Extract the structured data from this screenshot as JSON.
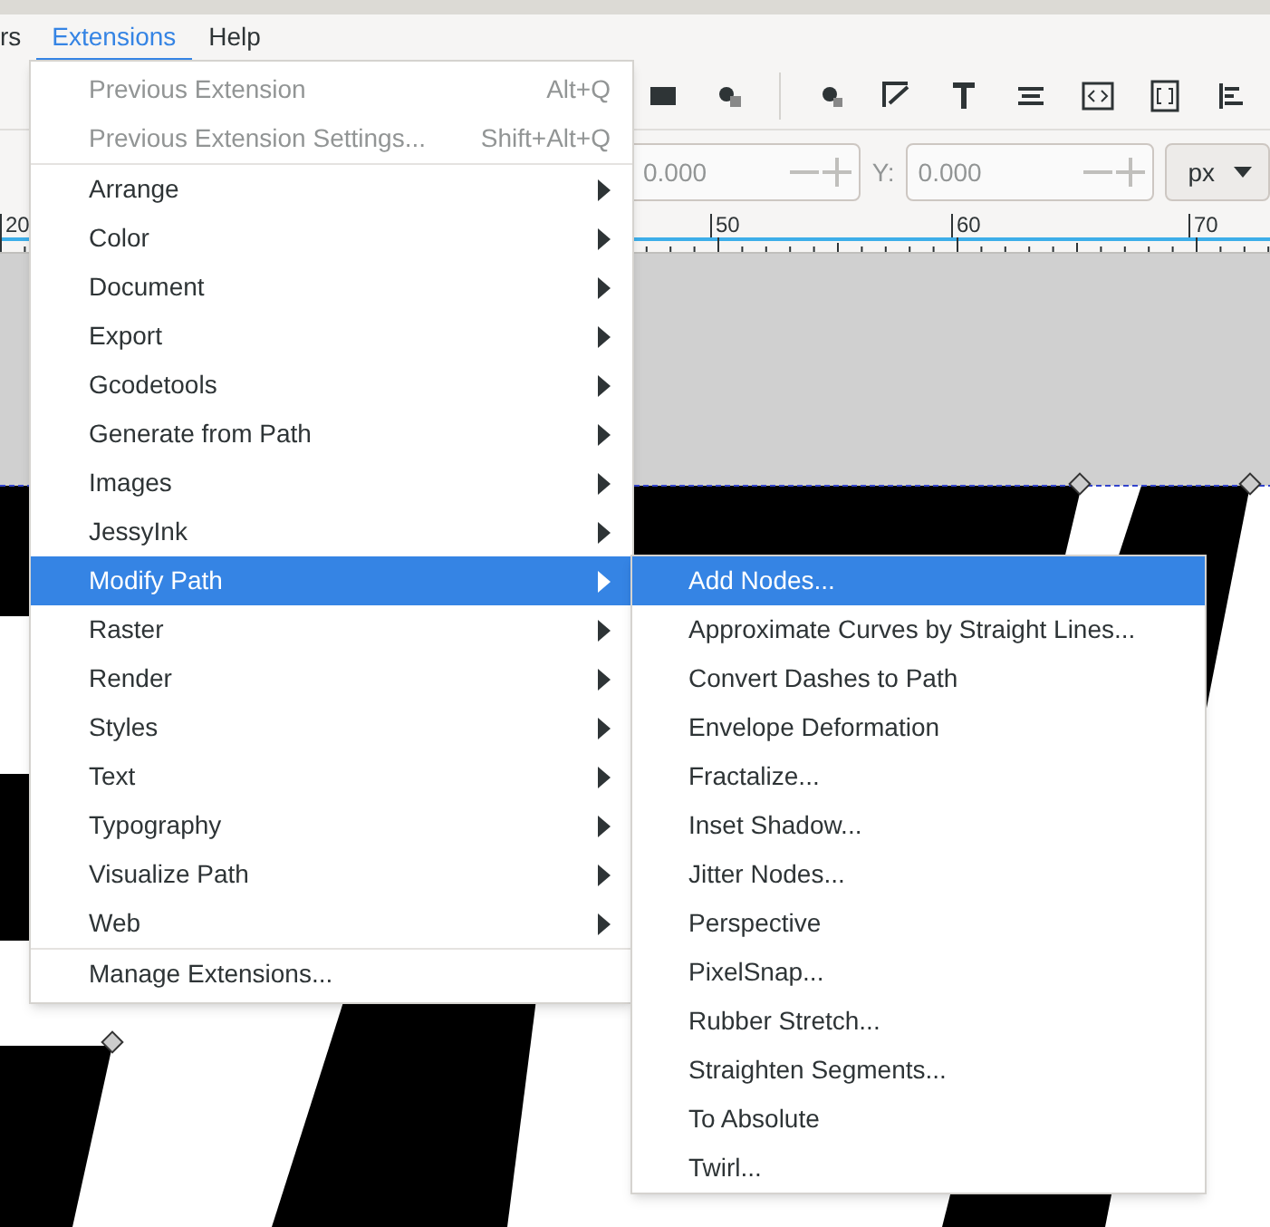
{
  "menubar": [
    {
      "label": "rs",
      "selected": false
    },
    {
      "label": "Extensions",
      "selected": true
    },
    {
      "label": "Help",
      "selected": false
    }
  ],
  "coordinates": {
    "x_value": "0.000",
    "y_label": "Y:",
    "y_value": "0.000",
    "unit": "px"
  },
  "ruler": {
    "labels": [
      "20",
      "50",
      "60",
      "70"
    ]
  },
  "extensions_menu": {
    "sections": [
      [
        {
          "kind": "action",
          "label": "Previous Extension",
          "shortcut": "Alt+Q",
          "disabled": true,
          "selected": false
        },
        {
          "kind": "action",
          "label": "Previous Extension Settings...",
          "shortcut": "Shift+Alt+Q",
          "disabled": true,
          "selected": false
        }
      ],
      [
        {
          "kind": "submenu",
          "label": "Arrange",
          "disabled": false,
          "selected": false
        },
        {
          "kind": "submenu",
          "label": "Color",
          "disabled": false,
          "selected": false
        },
        {
          "kind": "submenu",
          "label": "Document",
          "disabled": false,
          "selected": false
        },
        {
          "kind": "submenu",
          "label": "Export",
          "disabled": false,
          "selected": false
        },
        {
          "kind": "submenu",
          "label": "Gcodetools",
          "disabled": false,
          "selected": false
        },
        {
          "kind": "submenu",
          "label": "Generate from Path",
          "disabled": false,
          "selected": false
        },
        {
          "kind": "submenu",
          "label": "Images",
          "disabled": false,
          "selected": false
        },
        {
          "kind": "submenu",
          "label": "JessyInk",
          "disabled": false,
          "selected": false
        },
        {
          "kind": "submenu",
          "label": "Modify Path",
          "selected": true
        },
        {
          "kind": "submenu",
          "label": "Raster",
          "disabled": false,
          "selected": false
        },
        {
          "kind": "submenu",
          "label": "Render",
          "disabled": false,
          "selected": false
        },
        {
          "kind": "submenu",
          "label": "Styles",
          "disabled": false,
          "selected": false
        },
        {
          "kind": "submenu",
          "label": "Text",
          "disabled": false,
          "selected": false
        },
        {
          "kind": "submenu",
          "label": "Typography",
          "disabled": false,
          "selected": false
        },
        {
          "kind": "submenu",
          "label": "Visualize Path",
          "disabled": false,
          "selected": false
        },
        {
          "kind": "submenu",
          "label": "Web",
          "disabled": false,
          "selected": false
        }
      ],
      [
        {
          "kind": "action",
          "label": "Manage Extensions...",
          "disabled": false,
          "selected": false
        }
      ]
    ]
  },
  "modify_path_submenu": {
    "items": [
      {
        "label": "Add Nodes...",
        "selected": true
      },
      {
        "label": "Approximate Curves by Straight Lines...",
        "selected": false
      },
      {
        "label": "Convert Dashes to Path",
        "selected": false
      },
      {
        "label": "Envelope Deformation",
        "selected": false
      },
      {
        "label": "Fractalize...",
        "selected": false
      },
      {
        "label": "Inset Shadow...",
        "selected": false
      },
      {
        "label": "Jitter Nodes...",
        "selected": false
      },
      {
        "label": "Perspective",
        "selected": false
      },
      {
        "label": "PixelSnap...",
        "selected": false
      },
      {
        "label": "Rubber Stretch...",
        "selected": false
      },
      {
        "label": "Straighten Segments...",
        "selected": false
      },
      {
        "label": "To Absolute",
        "selected": false
      },
      {
        "label": "Twirl...",
        "selected": false
      }
    ]
  }
}
